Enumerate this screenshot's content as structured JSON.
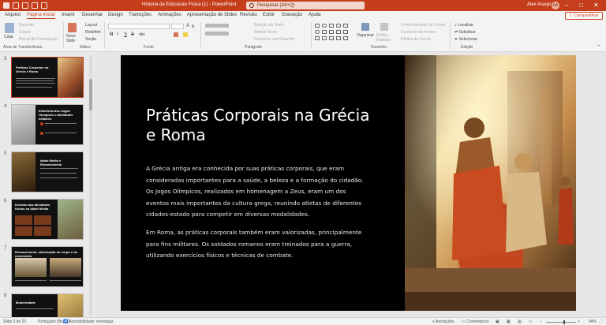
{
  "window": {
    "title": "Historia da Educacao Fisica (1)  -  PowerPoint",
    "search_placeholder": "Pesquisar (Alt+Q)",
    "user_name": "Alex Araujo",
    "user_initials": "AA",
    "controls": [
      "–",
      "□",
      "✕"
    ]
  },
  "menu": {
    "tabs": [
      "Arquivo",
      "Página Inicial",
      "Inserir",
      "Desenhar",
      "Design",
      "Transições",
      "Animações",
      "Apresentação de Slides",
      "Revisão",
      "Exibir",
      "Gravação",
      "Ajuda"
    ],
    "active_tab": "Página Inicial",
    "share_label": "Compartilhar"
  },
  "ribbon": {
    "clipboard": {
      "paste": "Colar",
      "cut": "Recortar",
      "copy": "Copiar",
      "format_painter": "Pincel de Formatação",
      "label": "Área de Transferência"
    },
    "slides": {
      "new_slide": "Novo Slide",
      "layout": "Layout",
      "reset": "Redefinir",
      "section": "Seção",
      "label": "Slides"
    },
    "font": {
      "label": "Fonte",
      "bold": "N",
      "italic": "I",
      "underline": "S",
      "strike": "S",
      "shadow": "abc",
      "size_up": "A",
      "size_down": "A"
    },
    "paragraph": {
      "text_direction": "Direção do Texto",
      "align_text": "Alinhar Texto",
      "smartart": "Converter em SmartArt",
      "label": "Parágrafo"
    },
    "drawing": {
      "arrange": "Organizar",
      "quick_styles": "Estilos Rápidos",
      "shape_fill": "Preenchimento da Forma",
      "shape_outline": "Contorno da Forma",
      "shape_effects": "Efeitos de Forma",
      "label": "Desenho"
    },
    "editing": {
      "find": "Localizar",
      "replace": "Substituir",
      "select": "Selecionar",
      "label": "Edição"
    }
  },
  "thumbnails": [
    {
      "number": "3",
      "title": "Práticas Corporais na Grécia e Roma",
      "selected": true
    },
    {
      "number": "4",
      "title": "Influência dos Jogos Olímpicos e atividades militares",
      "selected": false
    },
    {
      "number": "5",
      "title": "Idade Média e Renascimento",
      "selected": false
    },
    {
      "number": "6",
      "title": "Declínio das atividades físicas na Idade Média",
      "selected": false
    },
    {
      "number": "7",
      "title": "Renascimento: valorização do corpo e do movimento",
      "selected": false
    },
    {
      "number": "8",
      "title": "Modernidade",
      "selected": false
    }
  ],
  "slide": {
    "title_line1": "Práticas Corporais na Grécia",
    "title_line2": "e Roma",
    "para1": [
      "A Grécia antiga era conhecida por suas práticas corporais, que eram",
      "consideradas importantes para a saúde, a beleza e a formação do cidadão.",
      "Os Jogos Olímpicos, realizados em homenagem a Zeus, eram um dos",
      "eventos mais importantes da cultura grega, reunindo atletas de diferentes",
      "cidades-estado para competir em diversas modalidades."
    ],
    "para2": [
      "Em Roma, as práticas corporais também eram valorizadas, principalmente",
      "para fins militares. Os soldados romanos eram treinados para a guerra,",
      "utilizando exercícios físicos e técnicas de combate."
    ]
  },
  "status": {
    "slide_counter": "Slide 3 de 23",
    "language": "Português (Brasil)",
    "accessibility": "Acessibilidade: investigar",
    "notes": "Anotações",
    "comments": "Comentários",
    "zoom": "94%"
  },
  "colors": {
    "accent": "#c43e1c",
    "slide_bg": "#000000"
  }
}
